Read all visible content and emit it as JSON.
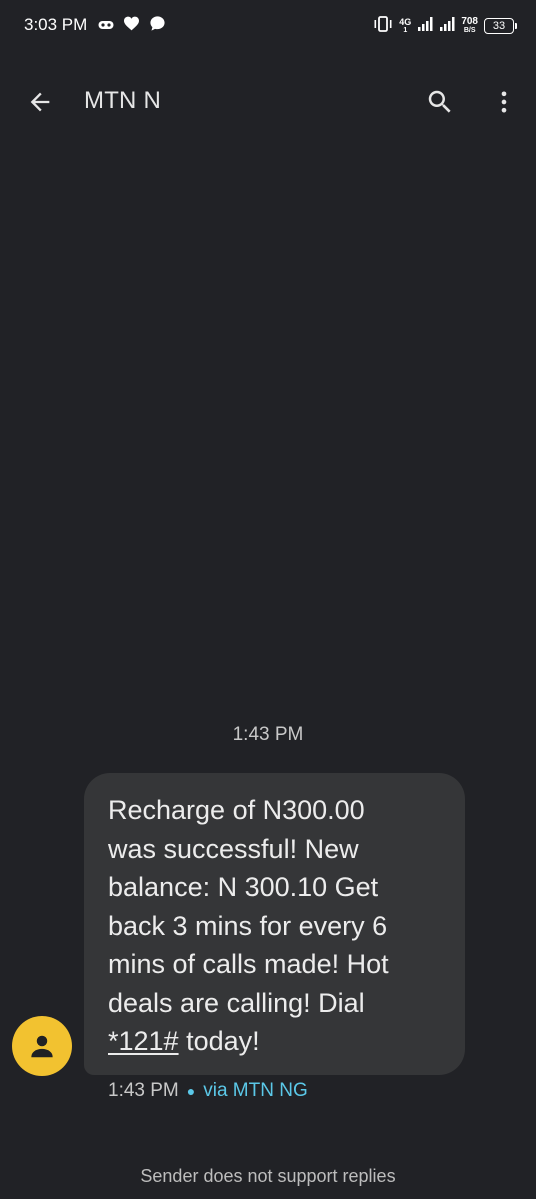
{
  "status_bar": {
    "time": "3:03 PM",
    "network_type": "4G",
    "network_sub": "1",
    "speed_value": "708",
    "speed_unit": "B/S",
    "battery_level": "33"
  },
  "header": {
    "title": "MTN N"
  },
  "conversation": {
    "timestamp": "1:43 PM",
    "message": {
      "lines": [
        "Recharge of N300.00",
        "was successful! New",
        "balance: N 300.10 Get",
        "back 3 mins for every 6",
        "mins of calls made! Hot",
        "deals are calling! Dial"
      ],
      "ussd_code": "*121#",
      "last_line_suffix": " today!"
    },
    "meta_time": "1:43 PM",
    "meta_via": "via MTN NG"
  },
  "footer": {
    "note": "Sender does not support replies"
  },
  "colors": {
    "background": "#212226",
    "bubble": "#353638",
    "avatar": "#f2c230",
    "accent": "#5bc8e8"
  }
}
